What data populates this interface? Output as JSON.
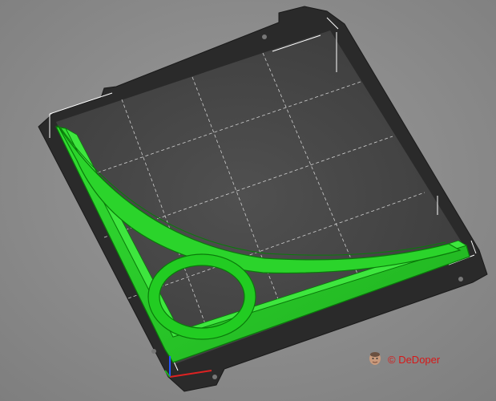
{
  "viewport": {
    "background_color": "#8c8c8c",
    "bed_color": "#2b2b2b",
    "surface_color": "#474747",
    "grid_color": "#d9d9d9",
    "part_color": "#22cc22",
    "part_edge_color": "#0a7a0a"
  },
  "scene": {
    "object": "curved-triangle-with-ring",
    "axes": [
      "x-axis",
      "y-axis",
      "z-axis"
    ]
  },
  "watermark": {
    "text": "© DeDoper",
    "color": "#d71818",
    "avatar": "avatar-icon"
  }
}
